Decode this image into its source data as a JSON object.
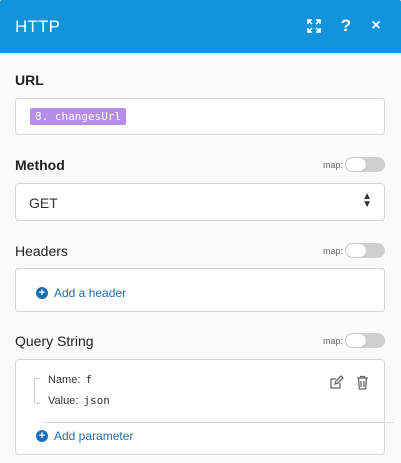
{
  "header": {
    "title": "HTTP",
    "help": "?",
    "close": "×",
    "bg_color": "#1294dc"
  },
  "url": {
    "label": "URL",
    "pill": "8. changesUrl",
    "pill_color": "#b68de8"
  },
  "method": {
    "label": "Method",
    "value": "GET",
    "map_label": "map:"
  },
  "headers": {
    "label": "Headers",
    "map_label": "map:",
    "add_label": "Add a header"
  },
  "query": {
    "label": "Query String",
    "map_label": "map:",
    "params": [
      {
        "name_label": "Name:",
        "name": "f",
        "value_label": "Value:",
        "value": "json"
      }
    ],
    "add_label": "Add parameter"
  },
  "icons": {
    "expand": "expand-icon",
    "help": "help-icon",
    "close": "close-icon",
    "caret": "sort-caret-icon",
    "plus": "plus-circle-icon",
    "edit": "edit-icon",
    "delete": "trash-icon"
  },
  "accent": "#1c6db3"
}
